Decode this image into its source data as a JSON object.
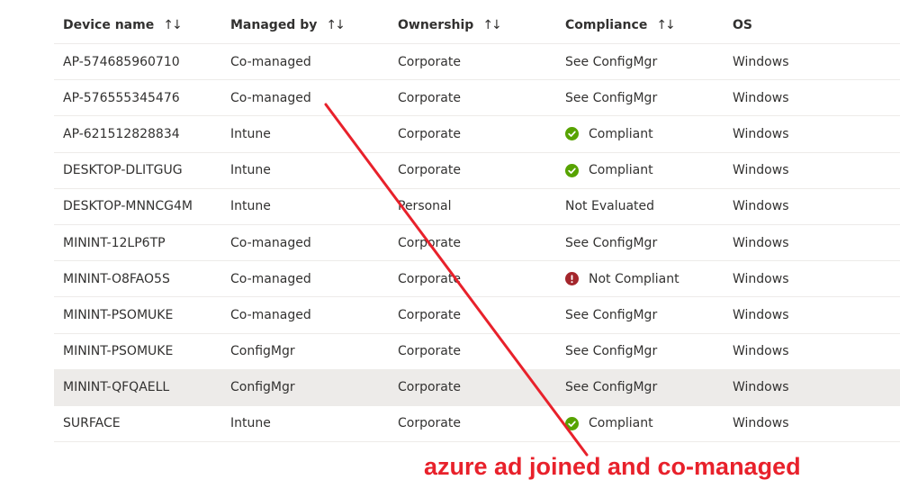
{
  "table": {
    "columns": [
      {
        "label": "Device name",
        "sortable": true
      },
      {
        "label": "Managed by",
        "sortable": true
      },
      {
        "label": "Ownership",
        "sortable": true
      },
      {
        "label": "Compliance",
        "sortable": true
      },
      {
        "label": "OS",
        "sortable": false
      }
    ],
    "sort_glyph": "↑↓",
    "rows": [
      {
        "device": "AP-574685960710",
        "managed_by": "Co-managed",
        "ownership": "Corporate",
        "compliance": "See ConfigMgr",
        "compliance_icon": "",
        "os": "Windows",
        "selected": false
      },
      {
        "device": "AP-576555345476",
        "managed_by": "Co-managed",
        "ownership": "Corporate",
        "compliance": "See ConfigMgr",
        "compliance_icon": "",
        "os": "Windows",
        "selected": false
      },
      {
        "device": "AP-621512828834",
        "managed_by": "Intune",
        "ownership": "Corporate",
        "compliance": "Compliant",
        "compliance_icon": "check-circle-icon",
        "os": "Windows",
        "selected": false
      },
      {
        "device": "DESKTOP-DLITGUG",
        "managed_by": "Intune",
        "ownership": "Corporate",
        "compliance": "Compliant",
        "compliance_icon": "check-circle-icon",
        "os": "Windows",
        "selected": false
      },
      {
        "device": "DESKTOP-MNNCG4M",
        "managed_by": "Intune",
        "ownership": "Personal",
        "compliance": "Not Evaluated",
        "compliance_icon": "",
        "os": "Windows",
        "selected": false
      },
      {
        "device": "MININT-12LP6TP",
        "managed_by": "Co-managed",
        "ownership": "Corporate",
        "compliance": "See ConfigMgr",
        "compliance_icon": "",
        "os": "Windows",
        "selected": false
      },
      {
        "device": "MININT-O8FAO5S",
        "managed_by": "Co-managed",
        "ownership": "Corporate",
        "compliance": "Not Compliant",
        "compliance_icon": "error-circle-icon",
        "os": "Windows",
        "selected": false
      },
      {
        "device": "MININT-PSOMUKE",
        "managed_by": "Co-managed",
        "ownership": "Corporate",
        "compliance": "See ConfigMgr",
        "compliance_icon": "",
        "os": "Windows",
        "selected": false
      },
      {
        "device": "MININT-PSOMUKE",
        "managed_by": "ConfigMgr",
        "ownership": "Corporate",
        "compliance": "See ConfigMgr",
        "compliance_icon": "",
        "os": "Windows",
        "selected": false
      },
      {
        "device": "MININT-QFQAELL",
        "managed_by": "ConfigMgr",
        "ownership": "Corporate",
        "compliance": "See ConfigMgr",
        "compliance_icon": "",
        "os": "Windows",
        "selected": true
      },
      {
        "device": "SURFACE",
        "managed_by": "Intune",
        "ownership": "Corporate",
        "compliance": "Compliant",
        "compliance_icon": "check-circle-icon",
        "os": "Windows",
        "selected": false
      }
    ]
  },
  "annotation": {
    "text": "azure ad joined and co-managed",
    "color": "#e8212b"
  },
  "colors": {
    "compliant": "#57a300",
    "not_compliant": "#a4262c",
    "selected_row": "#edebe9",
    "divider": "#edebe9"
  }
}
